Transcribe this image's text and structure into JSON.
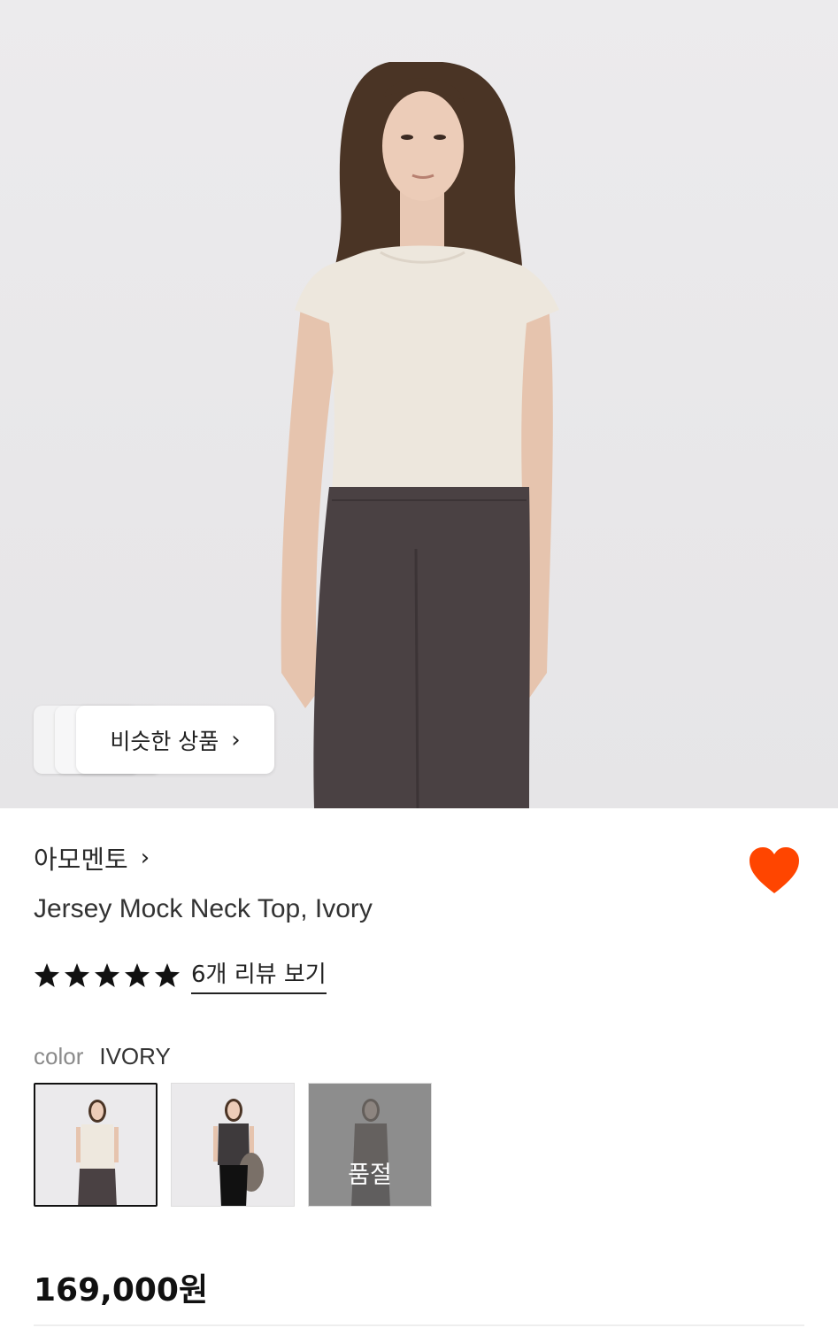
{
  "similar": {
    "label": "비슷한 상품",
    "chevron": "›"
  },
  "brand": {
    "name": "아모멘토",
    "chevron": "›"
  },
  "product": {
    "name": "Jersey Mock Neck Top, Ivory"
  },
  "rating": {
    "stars": 5,
    "review_link": "6개 리뷰 보기"
  },
  "color": {
    "label": "color",
    "value": "IVORY"
  },
  "swatches": [
    {
      "name": "ivory",
      "selected": true,
      "sold_out": false
    },
    {
      "name": "charcoal",
      "selected": false,
      "sold_out": false
    },
    {
      "name": "brown",
      "selected": false,
      "sold_out": true,
      "sold_label": "품절"
    }
  ],
  "price": {
    "value": "169,000원"
  },
  "colors": {
    "heart": "#FF4500",
    "accent": "#111111"
  },
  "icons": {
    "heart": "heart-icon",
    "star": "star-icon",
    "chevron": "chevron-right-icon"
  }
}
